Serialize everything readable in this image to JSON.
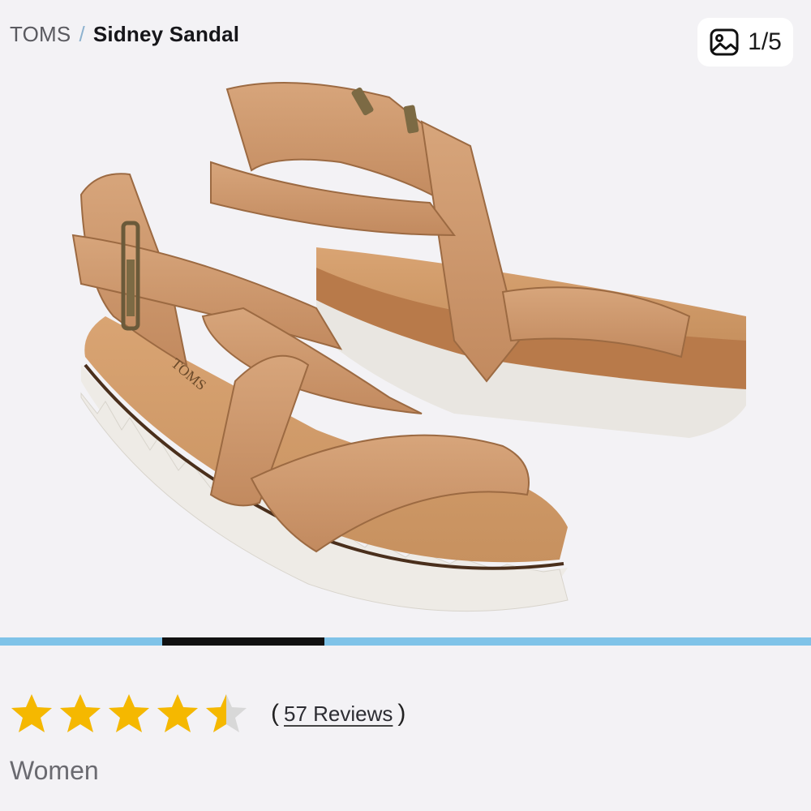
{
  "breadcrumb": {
    "brand": "TOMS",
    "separator": "/",
    "product": "Sidney Sandal"
  },
  "gallery": {
    "counter_icon": "image-icon",
    "counter_text": "1/5",
    "total_images": 5,
    "current_index": 1
  },
  "progress": {
    "segments": 5,
    "active_segment": 2,
    "active_color": "#111111",
    "inactive_color": "#7fc3e8"
  },
  "rating": {
    "value": 4.5,
    "max": 5,
    "star_color": "#f5b800",
    "empty_star_color": "#d8d8d8",
    "open_paren": "(",
    "reviews_label": "57 Reviews",
    "close_paren": ")"
  },
  "category": "Women",
  "colors": {
    "background": "#f3f2f5",
    "leather": "#c9946a",
    "sole": "#eeebe6"
  }
}
